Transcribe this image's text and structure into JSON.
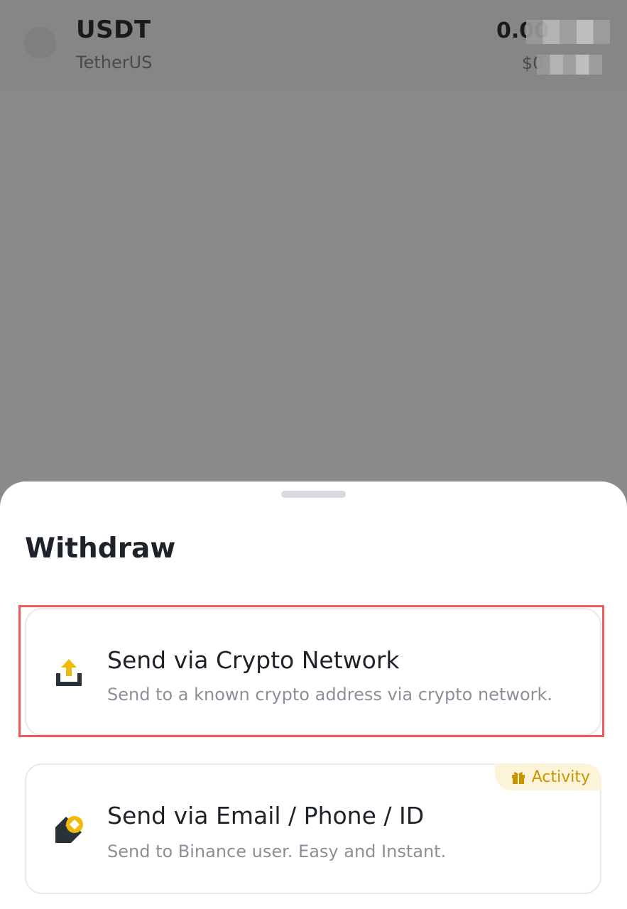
{
  "asset": {
    "symbol": "USDT",
    "name": "TetherUS",
    "amount": "0.00",
    "fiat_value": "$0."
  },
  "sheet": {
    "title": "Withdraw",
    "options": [
      {
        "title": "Send via Crypto Network",
        "description": "Send to a known crypto address via crypto network.",
        "icon": "upload-icon"
      },
      {
        "title": "Send via Email / Phone / ID",
        "description": "Send to Binance user. Easy and Instant.",
        "icon": "transfer-icon",
        "badge": "Activity"
      }
    ]
  },
  "colors": {
    "accent": "#F0B90B",
    "highlight": "#EF5A5A",
    "text_primary": "#1E2329",
    "text_secondary": "#8A9099",
    "overlay": "#8A8A8A"
  }
}
